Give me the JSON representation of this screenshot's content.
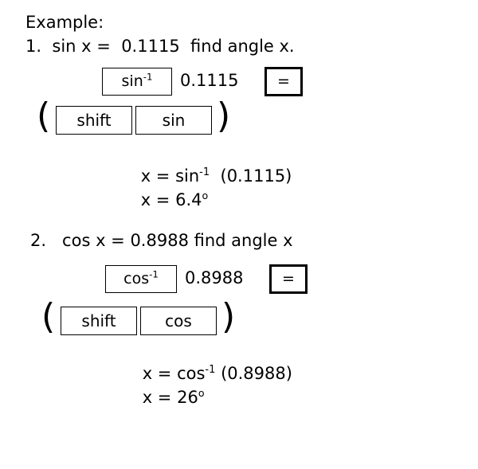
{
  "slide": {
    "background_color": "#ffffff",
    "text_color": "#000000",
    "heading": "Example:"
  },
  "examples": [
    {
      "number": "1.",
      "prompt": "1.  sin x =  0.1115  find angle x.",
      "calculator_sequence": {
        "function_key": "sin",
        "function_key_exponent": "-1",
        "value": "0.1115",
        "equals_key": "=",
        "open_paren": "(",
        "shift_key": "shift",
        "trig_key": "sin",
        "close_paren": ")"
      },
      "solution": {
        "line1_prefix": "x = sin",
        "line1_exponent": "-1",
        "line1_suffix": "  (0.1115)",
        "line2_prefix": "x = 6.4",
        "line2_degree": "o"
      }
    },
    {
      "number": "2.",
      "prompt": "2.   cos x = 0.8988 find angle x",
      "calculator_sequence": {
        "function_key": "cos",
        "function_key_exponent": "-1",
        "value": "0.8988",
        "equals_key": "=",
        "open_paren": "(",
        "shift_key": "shift",
        "trig_key": "cos",
        "close_paren": ")"
      },
      "solution": {
        "line1_prefix": "x = cos",
        "line1_exponent": "-1",
        "line1_suffix": " (0.8988)",
        "line2_prefix": "x = 26",
        "line2_degree": "o"
      }
    }
  ]
}
